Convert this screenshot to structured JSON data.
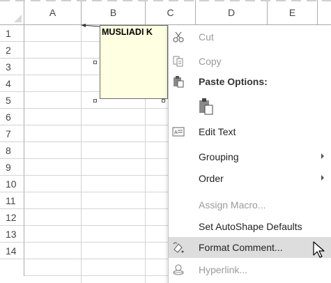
{
  "columns": [
    "A",
    "B",
    "C",
    "D",
    "E"
  ],
  "rows": [
    "1",
    "2",
    "3",
    "4",
    "5",
    "6",
    "7",
    "8",
    "9",
    "10",
    "11",
    "12",
    "13",
    "14"
  ],
  "comment": {
    "text": "MUSLIADI K"
  },
  "context_menu": {
    "cut": {
      "label": "Cut",
      "icon": "scissors-icon"
    },
    "copy": {
      "label": "Copy",
      "icon": "copy-icon"
    },
    "paste_options": {
      "label": "Paste Options:",
      "icon": "clipboard-icon"
    },
    "paste_button": {
      "icon": "paste-icon"
    },
    "edit_text": {
      "label": "Edit Text",
      "icon": "edit-text-icon"
    },
    "grouping": {
      "label": "Grouping",
      "has_submenu": true
    },
    "order": {
      "label": "Order",
      "has_submenu": true
    },
    "assign_macro": {
      "label": "Assign Macro...",
      "disabled": true
    },
    "set_defaults": {
      "label": "Set AutoShape Defaults"
    },
    "format_comment": {
      "label": "Format Comment...",
      "icon": "format-comment-icon",
      "highlighted": true
    },
    "hyperlink": {
      "label": "Hyperlink...",
      "icon": "link-icon",
      "disabled": true
    }
  },
  "colors": {
    "header_border": "#ababab",
    "grid": "#d4d4d4",
    "comment_fill": "#ffffe1",
    "hover": "#dddddd",
    "disabled": "#9a9a9a"
  }
}
